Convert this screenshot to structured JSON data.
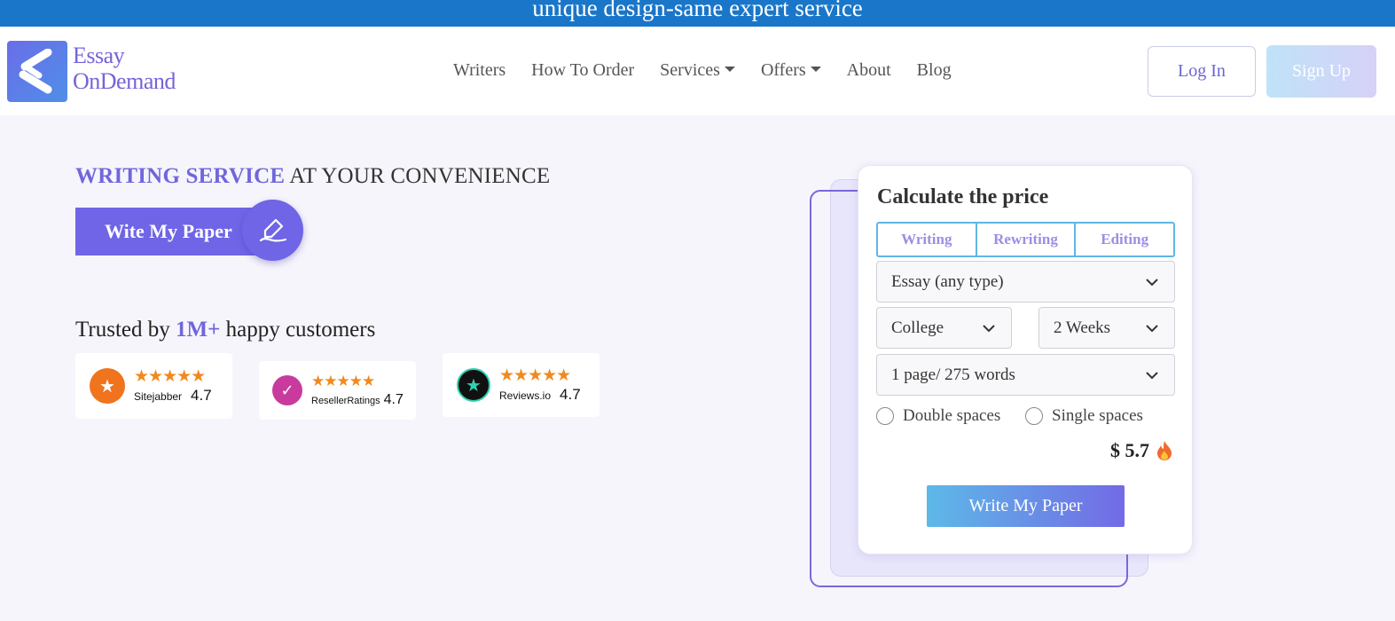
{
  "topbar": {
    "text": "unique design-same expert service"
  },
  "logo": {
    "line1": "Essay",
    "line2": "OnDemand"
  },
  "nav": {
    "items": [
      {
        "label": "Writers",
        "dropdown": false
      },
      {
        "label": "How To Order",
        "dropdown": false
      },
      {
        "label": "Services",
        "dropdown": true
      },
      {
        "label": "Offers",
        "dropdown": true
      },
      {
        "label": "About",
        "dropdown": false
      },
      {
        "label": "Blog",
        "dropdown": false
      }
    ]
  },
  "auth": {
    "login": "Log In",
    "signup": "Sign Up"
  },
  "hero": {
    "title_accent": "WRITING SERVICE",
    "title_rest": " AT YOUR CONVENIENCE",
    "cta": "Wite My Paper",
    "trusted_prefix": "Trusted by ",
    "trusted_accent": "1M+",
    "trusted_suffix": " happy customers"
  },
  "badges": [
    {
      "name": "Sitejabber",
      "score": "4.7",
      "stars": "★★★★★",
      "color": "#f0731e"
    },
    {
      "name": "ResellerRatings",
      "score": "4.7",
      "stars": "★★★★★",
      "color": "#c93a9e"
    },
    {
      "name": "Reviews.io",
      "score": "4.7",
      "stars": "★★★★★",
      "color": "#111111"
    }
  ],
  "calculator": {
    "title": "Calculate the price",
    "tabs": [
      "Writing",
      "Rewriting",
      "Editing"
    ],
    "paper_type": "Essay (any type)",
    "level": "College",
    "deadline": "2 Weeks",
    "pages": "1 page/ 275 words",
    "spacing": [
      "Double spaces",
      "Single spaces"
    ],
    "price": "$ 5.7",
    "cta": "Write My Paper"
  },
  "colors": {
    "accent": "#6f65e6",
    "topbar": "#1a76c9",
    "star": "#f08a1e"
  }
}
